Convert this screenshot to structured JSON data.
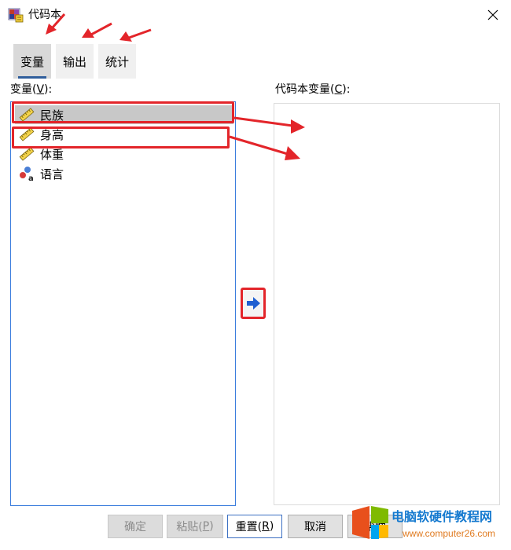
{
  "window": {
    "title": "代码本"
  },
  "tabs": [
    {
      "label": "变量",
      "active": true
    },
    {
      "label": "输出",
      "active": false
    },
    {
      "label": "统计",
      "active": false
    }
  ],
  "left_panel": {
    "label_prefix": "变量(",
    "label_accel": "V",
    "label_suffix": "):",
    "items": [
      {
        "label": "民族",
        "icon": "ruler-scale-icon",
        "selected": true
      },
      {
        "label": "身高",
        "icon": "ruler-scale-icon",
        "selected": false
      },
      {
        "label": "体重",
        "icon": "ruler-scale-icon",
        "selected": false
      },
      {
        "label": "语言",
        "icon": "nominal-variable-icon",
        "selected": false
      }
    ]
  },
  "right_panel": {
    "label_prefix": "代码本变量(",
    "label_accel": "C",
    "label_suffix": "):",
    "items": []
  },
  "buttons": {
    "ok": "确定",
    "paste_prefix": "粘贴(",
    "paste_accel": "P",
    "paste_suffix": ")",
    "reset_prefix": "重置(",
    "reset_accel": "R",
    "reset_suffix": ")",
    "cancel": "取消",
    "help": "帮助"
  },
  "watermark": {
    "title": "电脑软硬件教程网",
    "url": "www.computer26.com"
  },
  "colors": {
    "accent_blue": "#3b7ddd",
    "annotation_red": "#e3252a",
    "selected_bg": "#c8c8c8"
  }
}
